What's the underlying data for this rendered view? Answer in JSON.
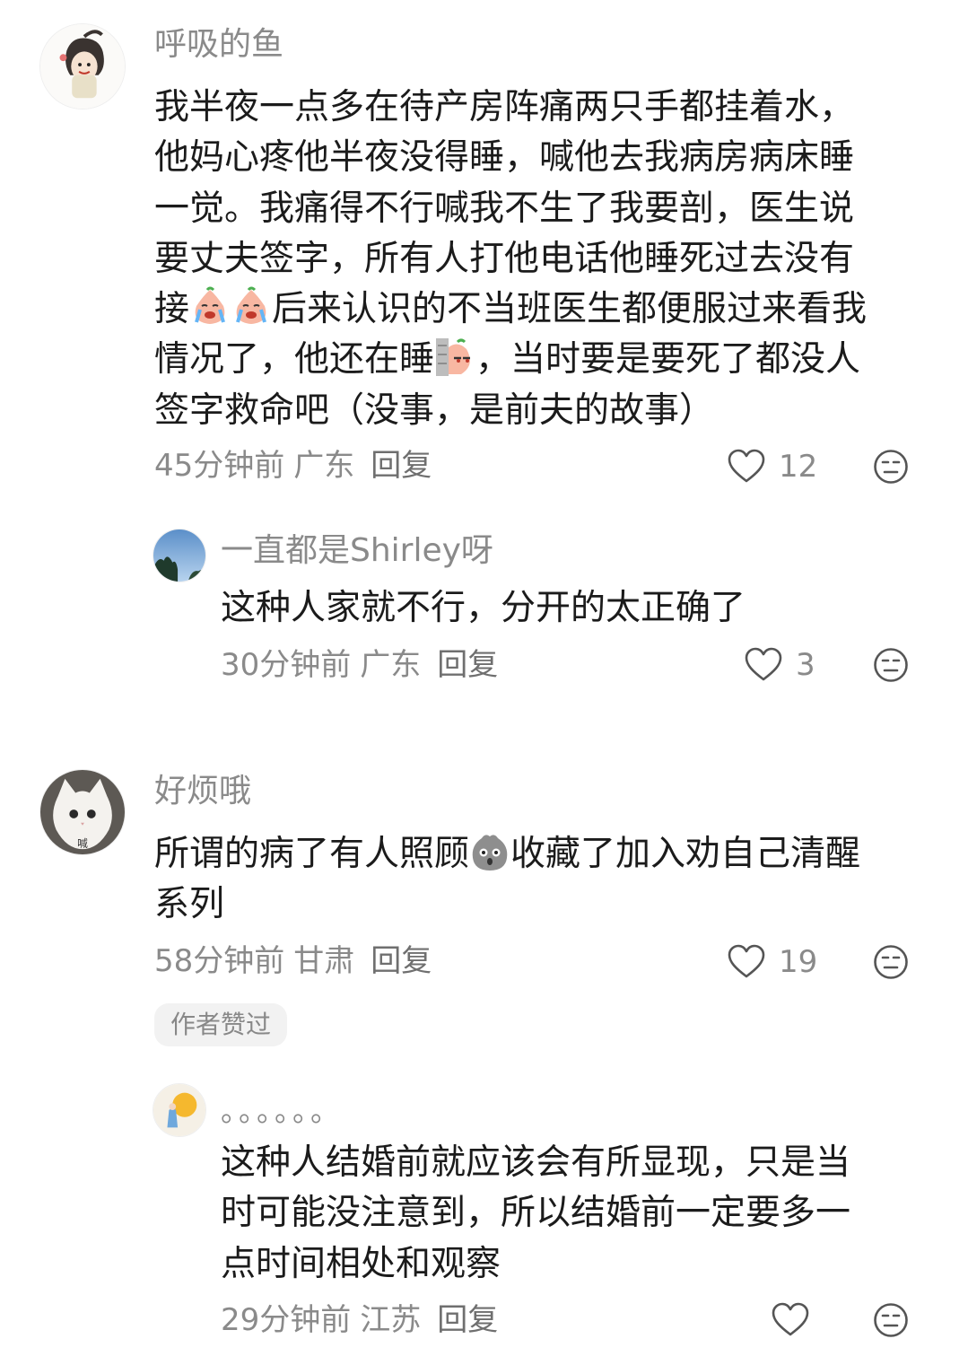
{
  "comments": [
    {
      "username": "呼吸的鱼",
      "lines": [
        "我半夜一点多在待产房阵痛两只手都挂着水，",
        "他妈心疼他半夜没得睡，喊他去我病房病床睡",
        "一觉。我痛得不行喊我不生了我要剖，医生说",
        "要丈夫签字，所有人打他电话他睡死过去没有"
      ],
      "line5_pre": "接",
      "line5_post": "后来认识的不当班医生都便服过来看我",
      "line6_pre": "情况了，他还在睡",
      "line6_post": "，当时要是要死了都没人",
      "line7": "签字救命吧（没事，是前夫的故事）",
      "time": "45分钟前",
      "location": "广东",
      "reply": "回复",
      "likes": "12",
      "avatar_icon": "cartoon-character-icon",
      "emojis": [
        "crying-emoji",
        "crying-emoji",
        "peeking-emoji"
      ]
    },
    {
      "username": "一直都是Shirley呀",
      "text": "这种人家就不行，分开的太正确了",
      "time": "30分钟前",
      "location": "广东",
      "reply": "回复",
      "likes": "3",
      "avatar_icon": "sky-photo-icon"
    },
    {
      "username": "好烦哦",
      "line1_pre": "所谓的病了有人照顾",
      "line1_post": "收藏了加入劝自己清醒",
      "line2": "系列",
      "time": "58分钟前",
      "location": "甘肃",
      "reply": "回复",
      "likes": "19",
      "badge": "作者赞过",
      "avatar_icon": "white-cat-icon",
      "avatar_label": "喊",
      "emojis": [
        "shocked-blob-emoji"
      ]
    },
    {
      "username": "。。。。。。",
      "lines": [
        "这种人结婚前就应该会有所显现，只是当",
        "时可能没注意到，所以结婚前一定要多一",
        "点时间相处和观察"
      ],
      "time": "29分钟前",
      "location": "江苏",
      "reply": "回复",
      "avatar_icon": "sun-illustration-icon"
    }
  ],
  "icons": {
    "like": "heart-outline-icon",
    "dislike": "neutral-face-icon"
  },
  "colors": {
    "text": "#1b1b1b",
    "secondary": "#8a8a8a",
    "badge_bg": "#f2f2f2"
  }
}
